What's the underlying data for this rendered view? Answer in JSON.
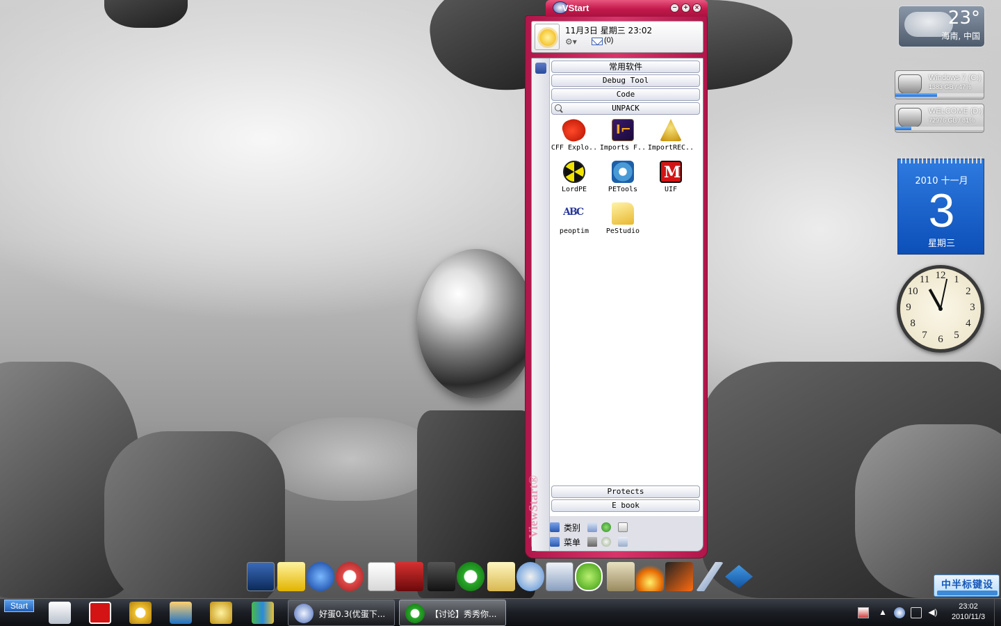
{
  "vstart": {
    "title": "VStart",
    "header": {
      "date_time": "11月3日 星期三 23:02",
      "mail_count": "(0)"
    },
    "categories_top": [
      {
        "label": "常用软件"
      },
      {
        "label": "Debug Tool"
      },
      {
        "label": "Code"
      },
      {
        "label": "UNPACK"
      }
    ],
    "apps": [
      {
        "label": "CFF Explo..",
        "icon": "cff-explorer-icon"
      },
      {
        "label": "Imports F..",
        "icon": "imports-fixer-icon"
      },
      {
        "label": "ImportREC..",
        "icon": "importrec-icon"
      },
      {
        "label": "LordPE",
        "icon": "lordpe-icon"
      },
      {
        "label": "PETools",
        "icon": "petools-icon"
      },
      {
        "label": "UIF",
        "icon": "uif-icon"
      },
      {
        "label": "peoptim",
        "icon": "peoptim-icon"
      },
      {
        "label": "PeStudio",
        "icon": "pestudio-icon"
      }
    ],
    "categories_bottom": [
      {
        "label": "Protects"
      },
      {
        "label": "E book"
      }
    ],
    "footer": {
      "category_label": "类别",
      "menu_label": "菜单"
    },
    "watermark": "ViewStart®"
  },
  "weather": {
    "temperature": "23°",
    "location": "海南, 中国"
  },
  "drives": [
    {
      "name": "Windows 7 (C:)",
      "info": "1383 GB / 47%",
      "usage": 0.47
    },
    {
      "name": "WELCOME (D:)",
      "info": "72976 GB / 81%",
      "usage": 0.18
    }
  ],
  "calendar": {
    "month": "2010 十一月",
    "day": "3",
    "weekday": "星期三"
  },
  "clock": {
    "numbers": [
      "12",
      "1",
      "2",
      "3",
      "4",
      "5",
      "6",
      "7",
      "8",
      "9",
      "10",
      "11"
    ],
    "time": "23:02"
  },
  "ime": {
    "label": "中半标键设"
  },
  "taskbar": {
    "start_label": "Start",
    "tasks": [
      {
        "label": "好蛋0.3(优蛋下..."
      },
      {
        "label": "【讨论】秀秀你..."
      }
    ],
    "clock_time": "23:02",
    "clock_date": "2010/11/3"
  }
}
